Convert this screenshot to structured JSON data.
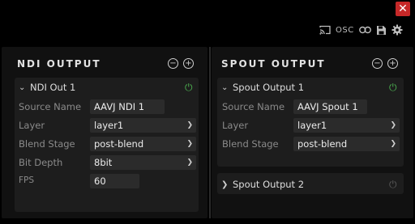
{
  "toolbar": {
    "osc_label": "OSC"
  },
  "ndi": {
    "title": "NDI OUTPUT",
    "remove_symbol": "−",
    "add_symbol": "+",
    "output1": {
      "name": "NDI Out 1",
      "source_name_label": "Source Name",
      "source_name_value": "AAVJ NDI 1",
      "layer_label": "Layer",
      "layer_value": "layer1",
      "blend_stage_label": "Blend Stage",
      "blend_stage_value": "post-blend",
      "bit_depth_label": "Bit Depth",
      "bit_depth_value": "8bit",
      "fps_label": "FPS",
      "fps_value": "60"
    }
  },
  "spout": {
    "title": "SPOUT OUTPUT",
    "remove_symbol": "−",
    "add_symbol": "+",
    "output1": {
      "name": "Spout Output 1",
      "source_name_label": "Source Name",
      "source_name_value": "AAVJ Spout 1",
      "layer_label": "Layer",
      "layer_value": "layer1",
      "blend_stage_label": "Blend Stage",
      "blend_stage_value": "post-blend"
    },
    "output2": {
      "name": "Spout Output 2"
    }
  },
  "colors": {
    "close_red": "#c62828",
    "power_active": "#4caf50",
    "power_inactive": "#5a5a5a"
  }
}
